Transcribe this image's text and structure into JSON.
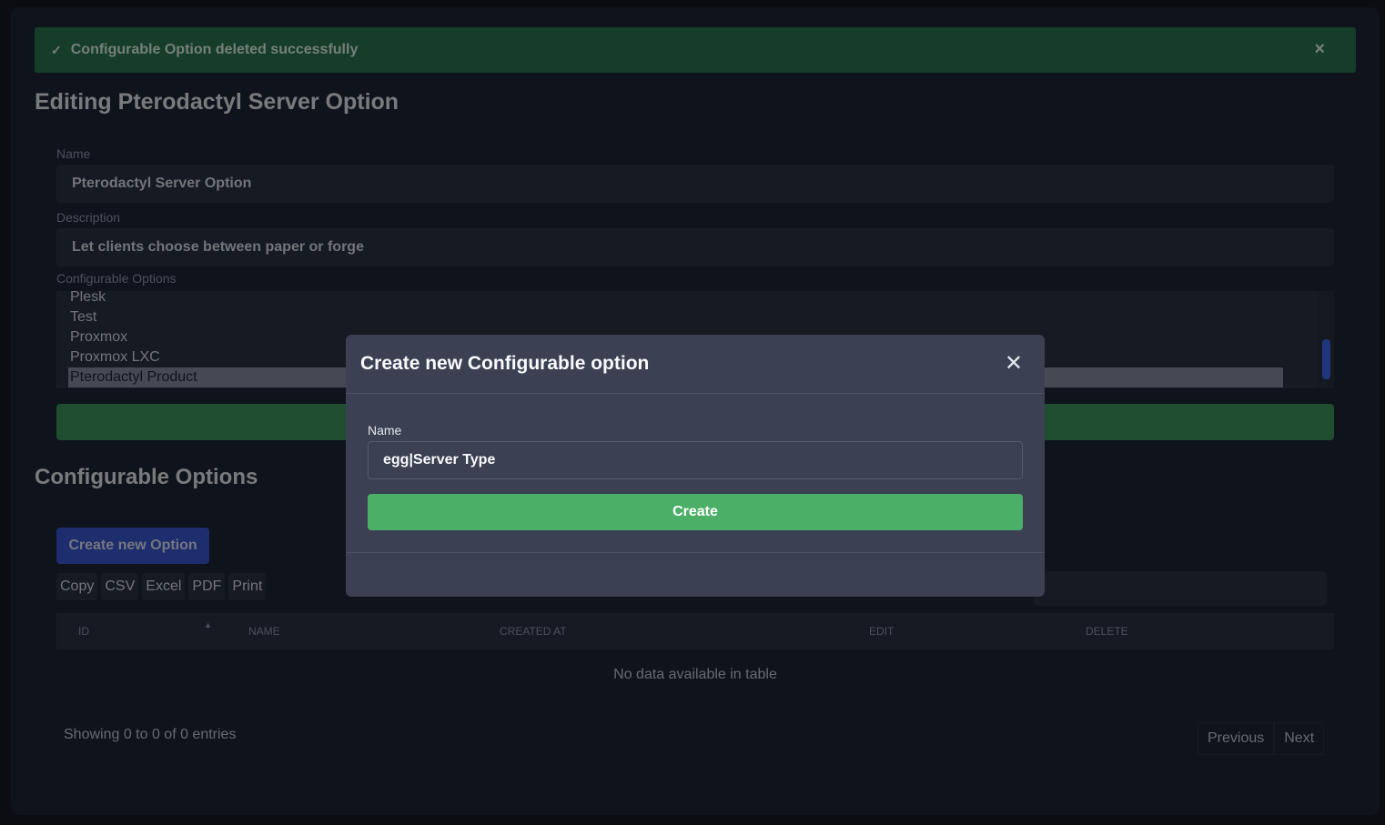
{
  "alert": {
    "text": "Configurable Option deleted successfully",
    "close": "×"
  },
  "page": {
    "title": "Editing Pterodactyl Server Option"
  },
  "form": {
    "name_label": "Name",
    "name_value": "Pterodactyl Server Option",
    "description_label": "Description",
    "description_value": "Let clients choose between paper or forge",
    "options_label": "Configurable Options",
    "options": [
      "Plesk",
      "Test",
      "Proxmox",
      "Proxmox LXC",
      "Pterodactyl Product"
    ]
  },
  "section": {
    "title": "Configurable Options",
    "create_button": "Create new Option",
    "export_buttons": [
      "Copy",
      "CSV",
      "Excel",
      "PDF",
      "Print"
    ]
  },
  "table": {
    "columns": [
      "ID",
      "NAME",
      "CREATED AT",
      "EDIT",
      "DELETE"
    ],
    "empty": "No data available in table",
    "info": "Showing 0 to 0 of 0 entries",
    "prev": "Previous",
    "next": "Next"
  },
  "modal": {
    "title": "Create new Configurable option",
    "close": "✕",
    "name_label": "Name",
    "name_value": "egg|Server Type",
    "create_button": "Create"
  }
}
